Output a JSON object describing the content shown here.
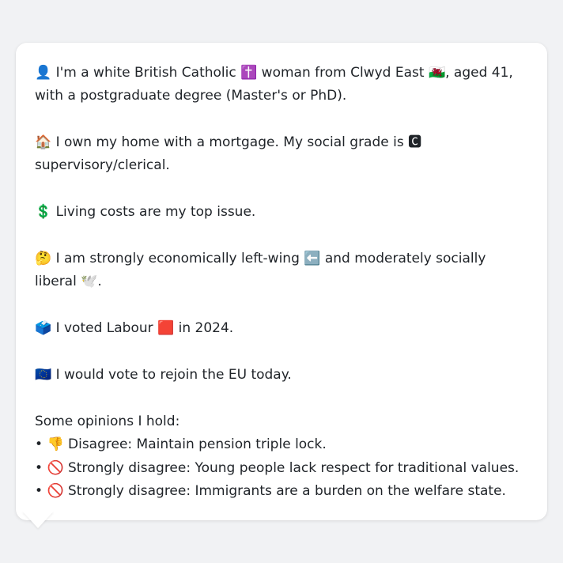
{
  "persona": {
    "intro": {
      "icon": "👤",
      "text_a": " I'm a white British Catholic ",
      "icon_religion": "✝️",
      "text_b": " woman from Clwyd East ",
      "icon_flag": "🏴󠁧󠁢󠁷󠁬󠁳󠁿",
      "text_c": ", aged 41, with a postgraduate degree (Master's or PhD)."
    },
    "home": {
      "icon": "🏠",
      "text_a": " I own my home with a mortgage. My social grade is ",
      "icon_grade": "🅲",
      "text_b": " supervisory/clerical."
    },
    "issue": {
      "icon": "💲",
      "text": " Living costs are my top issue."
    },
    "ideology": {
      "icon": "🤔",
      "text_a": " I am strongly economically left-wing ",
      "icon_left": "⬅️",
      "text_b": " and moderately socially liberal ",
      "icon_liberal": "🕊️",
      "text_c": "."
    },
    "vote": {
      "icon": "🗳️",
      "text_a": " I voted Labour ",
      "icon_party": "🟥",
      "text_b": " in 2024."
    },
    "eu": {
      "icon": "🇪🇺",
      "text": " I would vote to rejoin the EU today."
    },
    "opinions": {
      "heading": "Some opinions I hold:",
      "items": [
        {
          "bullet": "•",
          "icon": "👎",
          "text": " Disagree: Maintain pension triple lock."
        },
        {
          "bullet": "•",
          "icon": "🚫",
          "text": " Strongly disagree: Young people lack respect for traditional values."
        },
        {
          "bullet": "•",
          "icon": "🚫",
          "text": " Strongly disagree: Immigrants are a burden on the welfare state."
        }
      ]
    }
  }
}
